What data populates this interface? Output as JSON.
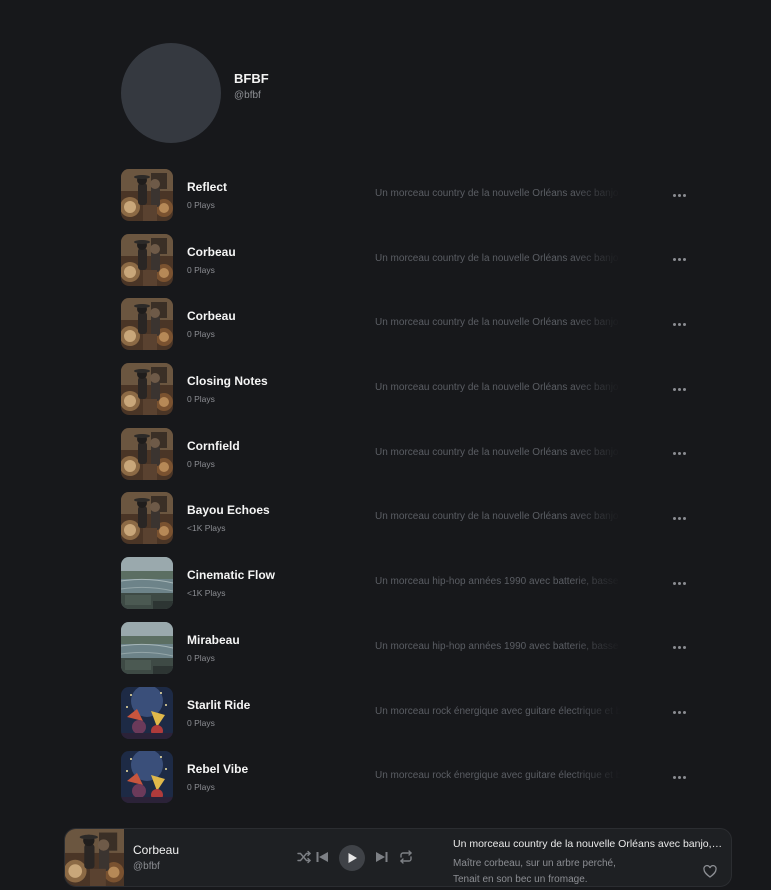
{
  "profile": {
    "name": "BFBF",
    "handle": "@bfbf"
  },
  "tracks": [
    {
      "title": "Reflect",
      "plays": "0 Plays",
      "description": "Un morceau country de la nouvelle Orléans avec banjo, trompette et batterie",
      "art": "country"
    },
    {
      "title": "Corbeau",
      "plays": "0 Plays",
      "description": "Un morceau country de la nouvelle Orléans avec banjo, trompette et batterie",
      "art": "country"
    },
    {
      "title": "Corbeau",
      "plays": "0 Plays",
      "description": "Un morceau country de la nouvelle Orléans avec banjo, trompette et batterie",
      "art": "country"
    },
    {
      "title": "Closing Notes",
      "plays": "0 Plays",
      "description": "Un morceau country de la nouvelle Orléans avec banjo, trompette et batterie",
      "art": "country"
    },
    {
      "title": "Cornfield",
      "plays": "0 Plays",
      "description": "Un morceau country de la nouvelle Orléans avec banjo, trompette et batterie",
      "art": "country"
    },
    {
      "title": "Bayou Echoes",
      "plays": "<1K Plays",
      "description": "Un morceau country de la nouvelle Orléans avec banjo, trompette et batterie",
      "art": "country"
    },
    {
      "title": "Cinematic Flow",
      "plays": "<1K Plays",
      "description": "Un morceau hip-hop années 1990 avec batterie, basse et samples",
      "art": "river"
    },
    {
      "title": "Mirabeau",
      "plays": "0 Plays",
      "description": "Un morceau hip-hop années 1990 avec batterie, basse et samples",
      "art": "river"
    },
    {
      "title": "Starlit Ride",
      "plays": "0 Plays",
      "description": "Un morceau rock énergique avec guitare électrique et batterie",
      "art": "rock"
    },
    {
      "title": "Rebel Vibe",
      "plays": "0 Plays",
      "description": "Un morceau rock énergique avec guitare électrique et batterie",
      "art": "rock"
    }
  ],
  "player": {
    "title": "Corbeau",
    "handle": "@bfbf",
    "description": "Un morceau country de la nouvelle Orléans avec banjo, trompette et batterie",
    "lyrics_line1": "Maître corbeau, sur un arbre perché,",
    "lyrics_line2": "Tenait en son bec un fromage."
  },
  "icons": {
    "more": "more-horizontal-icon",
    "shuffle": "shuffle-icon",
    "previous": "skip-back-icon",
    "play": "play-icon",
    "next": "skip-forward-icon",
    "repeat": "repeat-icon",
    "like": "heart-icon"
  },
  "colors": {
    "background": "#17181b",
    "avatar": "#353940",
    "description_text": "#5b5e64",
    "player_background": "#1e2023"
  }
}
